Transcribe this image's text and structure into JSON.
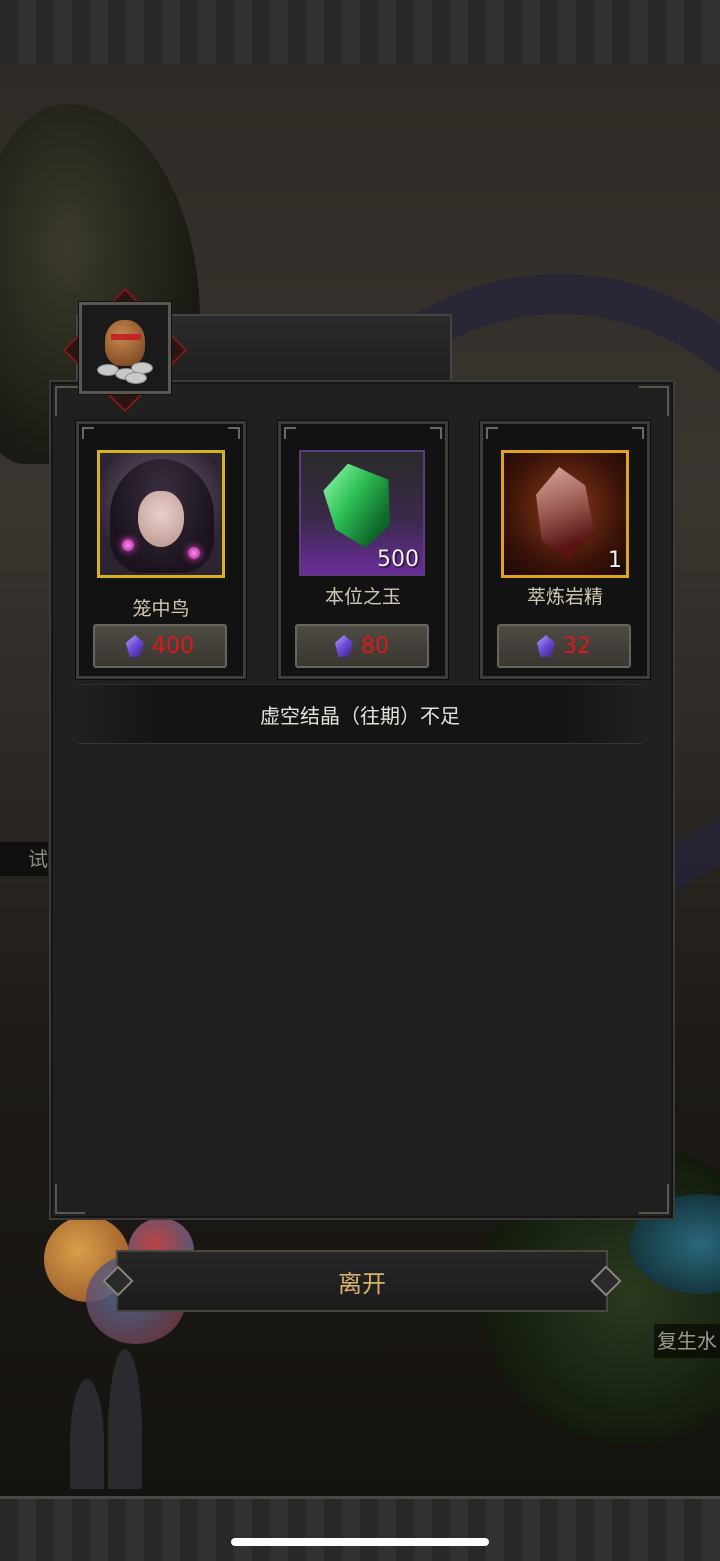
{
  "background": {
    "side_label_right": "复生水",
    "side_label_left": "试"
  },
  "dialog": {
    "header_icon": "money-bag-icon",
    "items": [
      {
        "name": "笼中鸟",
        "quantity": "",
        "price": "400",
        "currency_icon": "void-crystal-icon",
        "frame_color": "#d8b21c"
      },
      {
        "name": "本位之玉",
        "quantity": "500",
        "price": "80",
        "currency_icon": "void-crystal-icon",
        "frame_color": "#5e3a82"
      },
      {
        "name": "萃炼岩精",
        "quantity": "1",
        "price": "32",
        "currency_icon": "void-crystal-icon",
        "frame_color": "#e0a418"
      }
    ],
    "warning": "虚空结晶（往期）不足",
    "leave_button": "离开"
  },
  "colors": {
    "price_insufficient": "#e01818",
    "button_text": "#d9b06a"
  }
}
